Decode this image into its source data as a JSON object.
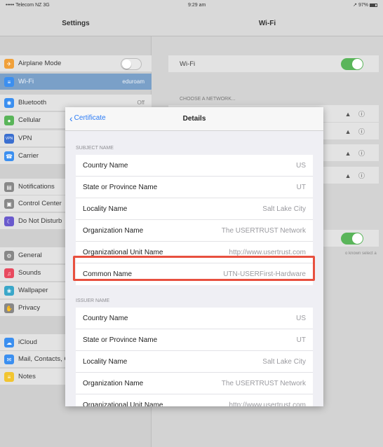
{
  "status": {
    "carrier": "••••• Telecom NZ  3G",
    "time": "9:29 am",
    "battery": "↗ 97%"
  },
  "left": {
    "title": "Settings",
    "items": [
      {
        "label": "Airplane Mode",
        "icon": "airplane-icon",
        "glyph": "✈",
        "color": "#f0a03a"
      },
      {
        "label": "Wi-Fi",
        "value": "eduroam",
        "icon": "wifi-icon",
        "glyph": "≡",
        "color": "#3b8ff0"
      },
      {
        "label": "Bluetooth",
        "value": "Off",
        "icon": "bluetooth-icon",
        "glyph": "✱",
        "color": "#3b8ff0"
      },
      {
        "label": "Cellular",
        "icon": "cellular-icon",
        "glyph": "●",
        "color": "#5ab55a"
      },
      {
        "label": "VPN",
        "icon": "vpn-icon",
        "glyph": "VPN",
        "color": "#3b6fd0"
      },
      {
        "label": "Carrier",
        "icon": "phone-icon",
        "glyph": "☎",
        "color": "#3b8ff0"
      },
      {
        "label": "Notifications",
        "icon": "notifications-icon",
        "glyph": "▤",
        "color": "#888888"
      },
      {
        "label": "Control Center",
        "icon": "control-center-icon",
        "glyph": "▣",
        "color": "#888888"
      },
      {
        "label": "Do Not Disturb",
        "icon": "moon-icon",
        "glyph": "☾",
        "color": "#6a5acd"
      },
      {
        "label": "General",
        "icon": "gear-icon",
        "glyph": "⚙",
        "color": "#888888"
      },
      {
        "label": "Sounds",
        "icon": "sounds-icon",
        "glyph": "♫",
        "color": "#e84a5f"
      },
      {
        "label": "Wallpaper",
        "icon": "wallpaper-icon",
        "glyph": "❀",
        "color": "#3aa7c9"
      },
      {
        "label": "Privacy",
        "icon": "privacy-icon",
        "glyph": "✋",
        "color": "#888888"
      },
      {
        "label": "iCloud",
        "icon": "icloud-icon",
        "glyph": "☁",
        "color": "#3b8ff0"
      },
      {
        "label": "Mail, Contacts, Calendars",
        "icon": "mail-icon",
        "glyph": "✉",
        "color": "#3b8ff0"
      },
      {
        "label": "Notes",
        "icon": "notes-icon",
        "glyph": "≡",
        "color": "#f2c531"
      }
    ]
  },
  "right": {
    "title": "Wi-Fi",
    "wifi_label": "Wi-Fi",
    "section": "CHOOSE A NETWORK...",
    "note": "o known select a",
    "accent": "#5ab55a"
  },
  "modal": {
    "back_label": "Certificate",
    "title": "Details",
    "subject_header": "SUBJECT NAME",
    "subject": [
      {
        "key": "Country Name",
        "value": "US"
      },
      {
        "key": "State or Province Name",
        "value": "UT"
      },
      {
        "key": "Locality Name",
        "value": "Salt Lake City"
      },
      {
        "key": "Organization Name",
        "value": "The USERTRUST Network"
      },
      {
        "key": "Organizational Unit Name",
        "value": "http://www.usertrust.com"
      },
      {
        "key": "Common Name",
        "value": "UTN-USERFirst-Hardware"
      }
    ],
    "issuer_header": "ISSUER NAME",
    "issuer": [
      {
        "key": "Country Name",
        "value": "US"
      },
      {
        "key": "State or Province Name",
        "value": "UT"
      },
      {
        "key": "Locality Name",
        "value": "Salt Lake City"
      },
      {
        "key": "Organization Name",
        "value": "The USERTRUST Network"
      },
      {
        "key": "Organizational Unit Name",
        "value": "http://www.usertrust.com"
      }
    ],
    "highlight_color": "#e8503f"
  }
}
